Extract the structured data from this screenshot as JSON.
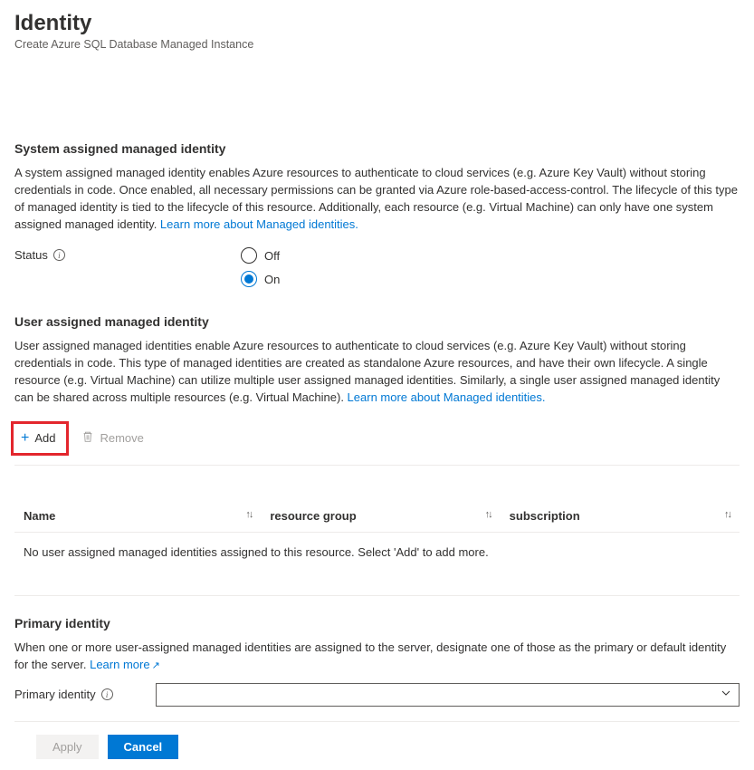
{
  "page": {
    "title": "Identity",
    "subtitle": "Create Azure SQL Database Managed Instance"
  },
  "system": {
    "heading": "System assigned managed identity",
    "desc": "A system assigned managed identity enables Azure resources to authenticate to cloud services (e.g. Azure Key Vault) without storing credentials in code. Once enabled, all necessary permissions can be granted via Azure role-based-access-control. The lifecycle of this type of managed identity is tied to the lifecycle of this resource. Additionally, each resource (e.g. Virtual Machine) can only have one system assigned managed identity. ",
    "learn": "Learn more about Managed identities.",
    "statusLabel": "Status",
    "options": {
      "off": "Off",
      "on": "On"
    },
    "selected": "on"
  },
  "user": {
    "heading": "User assigned managed identity",
    "desc": "User assigned managed identities enable Azure resources to authenticate to cloud services (e.g. Azure Key Vault) without storing credentials in code. This type of managed identities are created as standalone Azure resources, and have their own lifecycle. A single resource (e.g. Virtual Machine) can utilize multiple user assigned managed identities. Similarly, a single user assigned managed identity can be shared across multiple resources (e.g. Virtual Machine). ",
    "learn": "Learn more about Managed identities.",
    "addLabel": "Add",
    "removeLabel": "Remove",
    "columns": {
      "name": "Name",
      "rg": "resource group",
      "sub": "subscription"
    },
    "empty": "No user assigned managed identities assigned to this resource. Select 'Add' to add more."
  },
  "primary": {
    "heading": "Primary identity",
    "desc": "When one or more user-assigned managed identities are assigned to the server, designate one of those as the primary or default identity for the server. ",
    "learn": "Learn more",
    "label": "Primary identity"
  },
  "footer": {
    "apply": "Apply",
    "cancel": "Cancel"
  }
}
